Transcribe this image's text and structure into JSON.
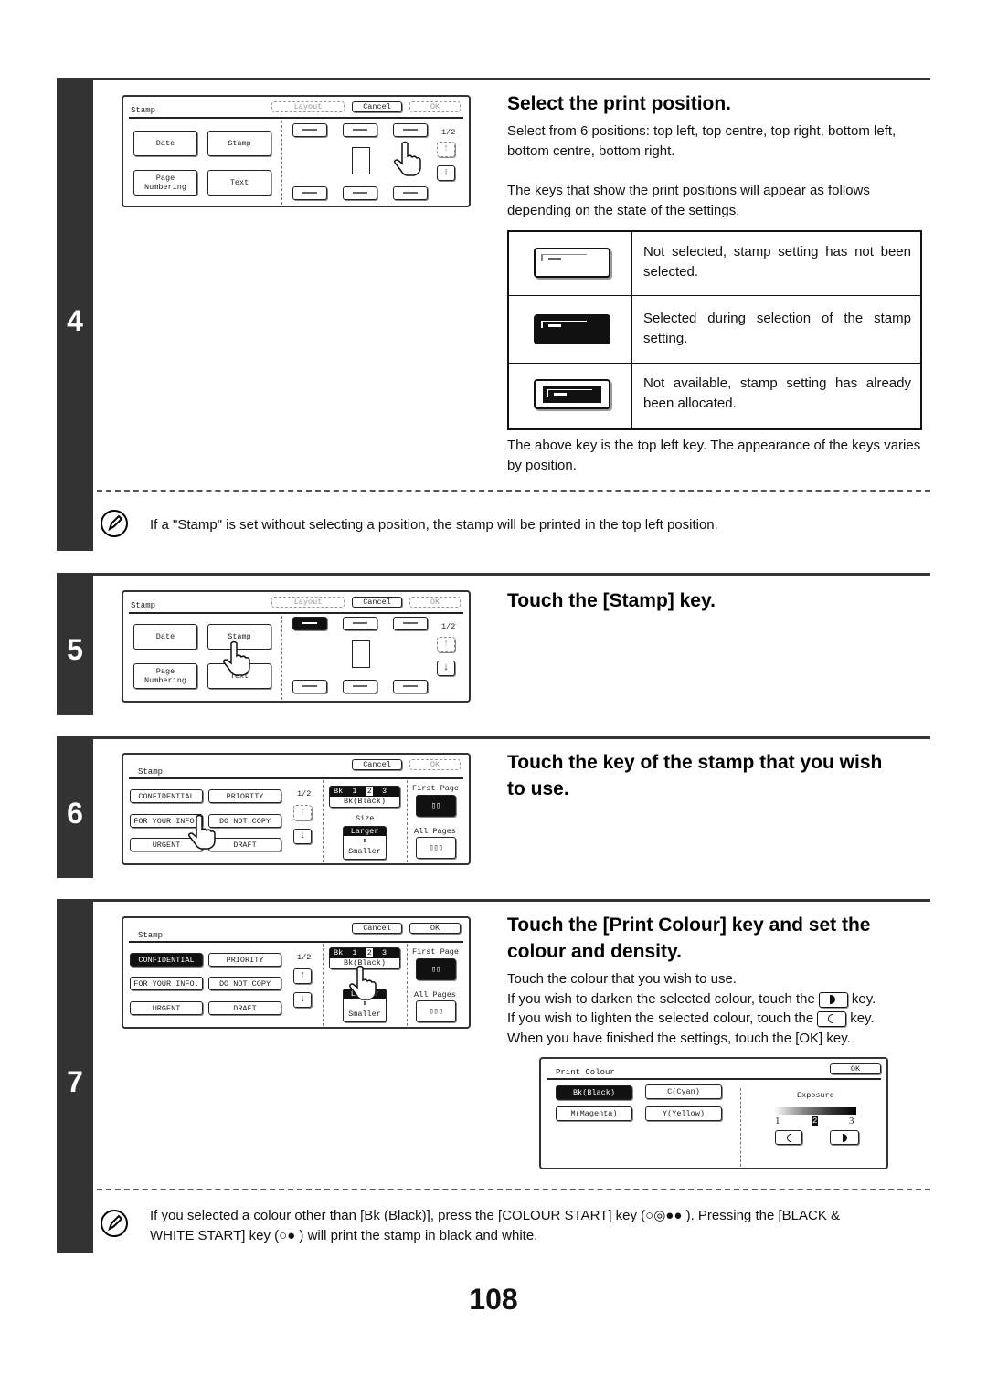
{
  "page_number": "108",
  "steps": {
    "step4": {
      "number": "4",
      "heading": "Select the print position.",
      "para1": "Select from 6 positions: top left, top centre, top right, bottom left, bottom centre, bottom right.",
      "para2": "The keys that show the print positions will appear as follows depending on the state of the settings.",
      "key_states": [
        {
          "state": "not-selected",
          "description": "Not selected, stamp setting has not been selected."
        },
        {
          "state": "selected",
          "description": "Selected during selection of the stamp setting."
        },
        {
          "state": "not-available",
          "description": "Not available, stamp setting has already been allocated."
        }
      ],
      "after_table": "The above key is the top left key. The appearance of the keys varies by position.",
      "note": "If a \"Stamp\" is set without selecting a position, the stamp will be printed in the top left position.",
      "panel": {
        "title": "Stamp",
        "layout_label": "Layout",
        "cancel_label": "Cancel",
        "ok_label": "OK",
        "buttons": [
          "Date",
          "Stamp",
          "Page\nNumbering",
          "Text"
        ],
        "page_indicator": "1/2",
        "up_icon": "arrow-up-icon",
        "down_icon": "arrow-down-icon"
      }
    },
    "step5": {
      "number": "5",
      "heading": "Touch the [Stamp] key.",
      "panel": {
        "title": "Stamp",
        "layout_label": "Layout",
        "cancel_label": "Cancel",
        "ok_label": "OK",
        "buttons": [
          "Date",
          "Stamp",
          "Page\nNumbering",
          "Text"
        ],
        "page_indicator": "1/2"
      }
    },
    "step6": {
      "number": "6",
      "heading": "Touch the key of the stamp that you wish to use.",
      "panel": {
        "title": "Stamp",
        "cancel_label": "Cancel",
        "ok_label": "OK",
        "stamps": [
          "CONFIDENTIAL",
          "PRIORITY",
          "FOR YOUR INFO.",
          "DO NOT COPY",
          "URGENT",
          "DRAFT"
        ],
        "page_indicator": "1/2",
        "colour_row": {
          "prefix": "Bk",
          "levels": [
            "1",
            "2",
            "3"
          ],
          "selected_level": "2"
        },
        "colour_label": "Bk(Black)",
        "size_label": "Size",
        "size_larger": "Larger",
        "size_smaller": "Smaller",
        "first_page_label": "First Page",
        "all_pages_label": "All Pages"
      }
    },
    "step7": {
      "number": "7",
      "heading": "Touch the [Print Colour] key and set the colour and density.",
      "line1": "Touch the colour that you wish to use.",
      "line2a": "If you wish to darken the selected colour, touch the",
      "line3a": "If you wish to lighten the selected colour, touch the",
      "key_suffix": "key.",
      "line4": "When you have finished the settings, touch the [OK] key.",
      "note_line1": "If you selected a colour other than [Bk (Black)], press the [COLOUR START] key (○◎●● ). Pressing the [BLACK &",
      "note_line2": "WHITE START] key (○● ) will print the stamp in black and white.",
      "panel": {
        "title": "Stamp",
        "cancel_label": "Cancel",
        "ok_label": "OK",
        "stamps": [
          "CONFIDENTIAL",
          "PRIORITY",
          "FOR YOUR INFO.",
          "DO NOT COPY",
          "URGENT",
          "DRAFT"
        ],
        "selected_stamp": "CONFIDENTIAL",
        "page_indicator": "1/2",
        "colour_row": {
          "prefix": "Bk",
          "levels": [
            "1",
            "2",
            "3"
          ],
          "selected_level": "2"
        },
        "colour_label": "Bk(Black)",
        "size_larger": "Larger",
        "size_smaller": "Smaller",
        "first_page_label": "First Page",
        "all_pages_label": "All Pages"
      },
      "print_colour_panel": {
        "title": "Print Colour",
        "ok_label": "OK",
        "colours": [
          "Bk(Black)",
          "C(Cyan)",
          "M(Magenta)",
          "Y(Yellow)"
        ],
        "selected_colour": "Bk(Black)",
        "exposure_label": "Exposure",
        "exposure_min": "1",
        "exposure_value": "2",
        "exposure_max": "3"
      }
    }
  }
}
